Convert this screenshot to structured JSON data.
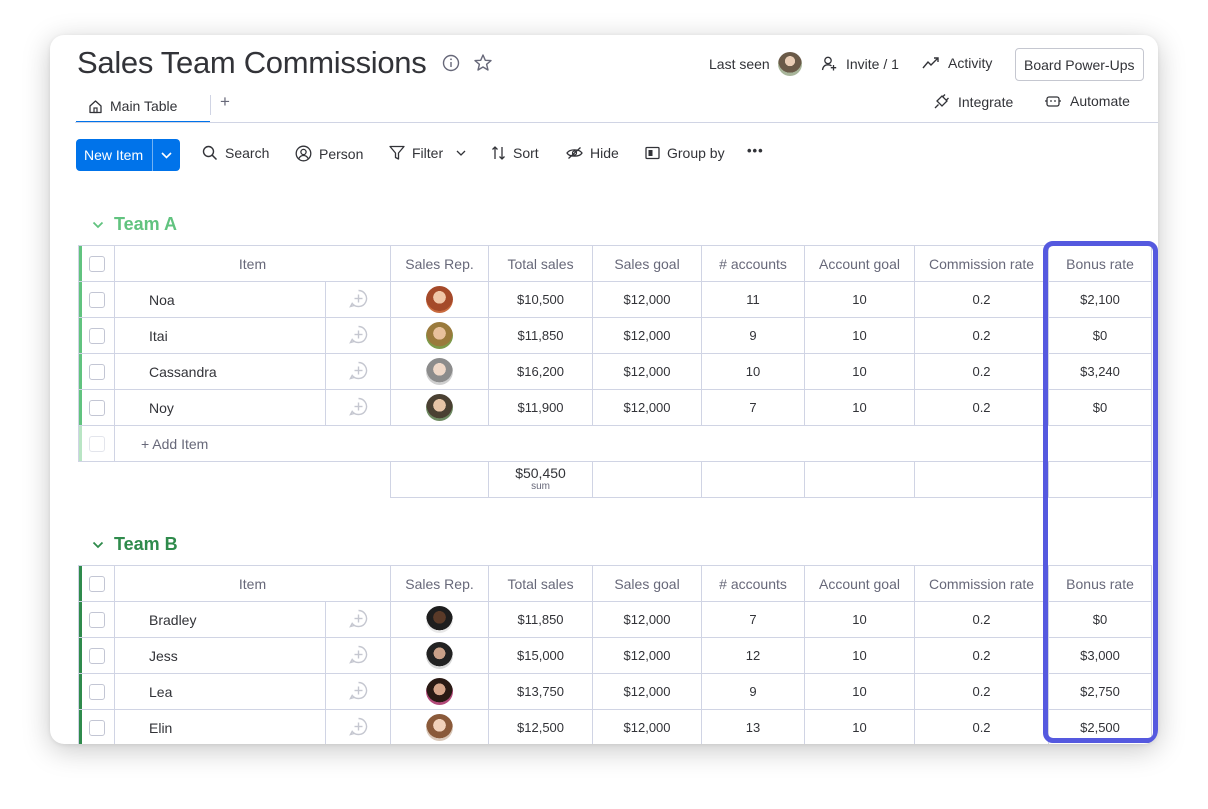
{
  "board": {
    "title": "Sales Team Commissions",
    "info_icon": "info-icon",
    "star_icon": "star-icon"
  },
  "header": {
    "last_seen_label": "Last seen",
    "invite_label": "Invite / 1",
    "activity_label": "Activity",
    "power_ups_label": "Board Power-Ups",
    "integrate_label": "Integrate",
    "automate_label": "Automate"
  },
  "tabs": {
    "main_label": "Main Table",
    "add_label": "+"
  },
  "toolbar": {
    "new_item_label": "New Item",
    "search_label": "Search",
    "person_label": "Person",
    "filter_label": "Filter",
    "sort_label": "Sort",
    "hide_label": "Hide",
    "group_by_label": "Group by",
    "more_label": "•••"
  },
  "columns": [
    "Item",
    "Sales Rep.",
    "Total sales",
    "Sales goal",
    "# accounts",
    "Account goal",
    "Commission rate",
    "Bonus rate"
  ],
  "colors": {
    "accent": "#0073ea",
    "team_a": "#61c37f",
    "team_b": "#2f8b4c",
    "highlight": "#5559df"
  },
  "groups": [
    {
      "name": "Team A",
      "rows": [
        {
          "item": "Noa",
          "total_sales": "$10,500",
          "sales_goal": "$12,000",
          "accounts": "11",
          "account_goal": "10",
          "commission_rate": "0.2",
          "bonus_rate": "$2,100"
        },
        {
          "item": "Itai",
          "total_sales": "$11,850",
          "sales_goal": "$12,000",
          "accounts": "9",
          "account_goal": "10",
          "commission_rate": "0.2",
          "bonus_rate": "$0"
        },
        {
          "item": "Cassandra",
          "total_sales": "$16,200",
          "sales_goal": "$12,000",
          "accounts": "10",
          "account_goal": "10",
          "commission_rate": "0.2",
          "bonus_rate": "$3,240"
        },
        {
          "item": "Noy",
          "total_sales": "$11,900",
          "sales_goal": "$12,000",
          "accounts": "7",
          "account_goal": "10",
          "commission_rate": "0.2",
          "bonus_rate": "$0"
        }
      ],
      "add_item_label": "+ Add Item",
      "summary": {
        "total_sales": "$50,450",
        "label": "sum"
      }
    },
    {
      "name": "Team B",
      "rows": [
        {
          "item": "Bradley",
          "total_sales": "$11,850",
          "sales_goal": "$12,000",
          "accounts": "7",
          "account_goal": "10",
          "commission_rate": "0.2",
          "bonus_rate": "$0"
        },
        {
          "item": "Jess",
          "total_sales": "$15,000",
          "sales_goal": "$12,000",
          "accounts": "12",
          "account_goal": "10",
          "commission_rate": "0.2",
          "bonus_rate": "$3,000"
        },
        {
          "item": "Lea",
          "total_sales": "$13,750",
          "sales_goal": "$12,000",
          "accounts": "9",
          "account_goal": "10",
          "commission_rate": "0.2",
          "bonus_rate": "$2,750"
        },
        {
          "item": "Elin",
          "total_sales": "$12,500",
          "sales_goal": "$12,000",
          "accounts": "13",
          "account_goal": "10",
          "commission_rate": "0.2",
          "bonus_rate": "$2,500"
        }
      ]
    }
  ]
}
